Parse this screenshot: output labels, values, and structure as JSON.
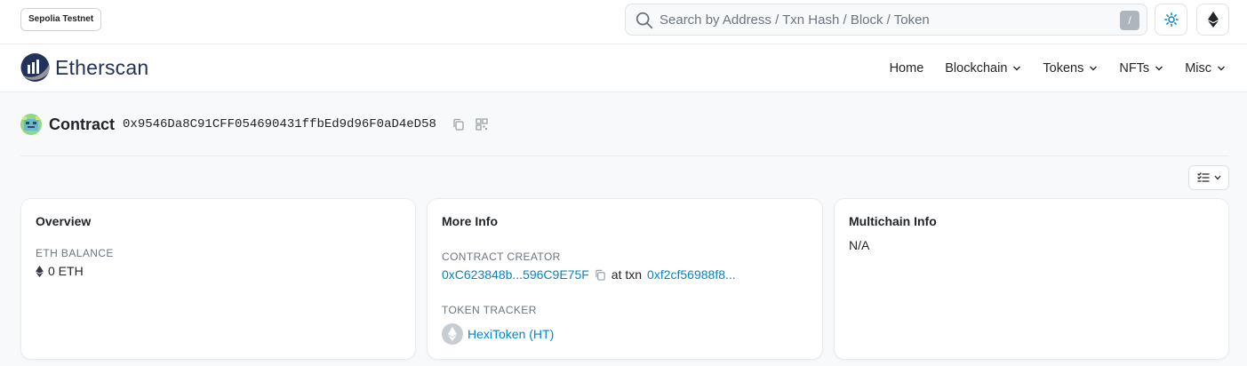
{
  "header": {
    "network_badge": "Sepolia Testnet",
    "search_placeholder": "Search by Address / Txn Hash / Block / Token",
    "search_shortcut": "/"
  },
  "brand": {
    "name": "Etherscan"
  },
  "nav": {
    "items": [
      {
        "label": "Home",
        "has_dropdown": false
      },
      {
        "label": "Blockchain",
        "has_dropdown": true
      },
      {
        "label": "Tokens",
        "has_dropdown": true
      },
      {
        "label": "NFTs",
        "has_dropdown": true
      },
      {
        "label": "Misc",
        "has_dropdown": true
      }
    ]
  },
  "contract": {
    "title": "Contract",
    "address": "0x9546Da8C91CFF054690431ffbEd9d96F0aD4eD58"
  },
  "overview": {
    "title": "Overview",
    "eth_balance_label": "ETH BALANCE",
    "eth_balance": "0 ETH"
  },
  "more_info": {
    "title": "More Info",
    "creator_label": "CONTRACT CREATOR",
    "creator_address": "0xC623848b...596C9E75F",
    "at_txn_text": "at txn",
    "creation_txn": "0xf2cf56988f8...",
    "token_tracker_label": "TOKEN TRACKER",
    "token_name": "HexiToken (HT)"
  },
  "multichain": {
    "title": "Multichain Info",
    "value": "N/A"
  },
  "colors": {
    "link": "#0784c3",
    "brand": "#21325b",
    "muted": "#6c757d"
  }
}
